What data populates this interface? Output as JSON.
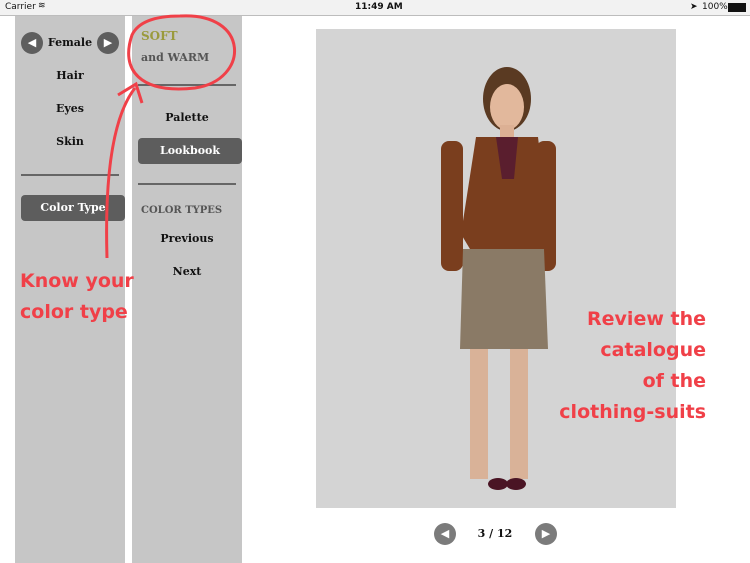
{
  "status": {
    "carrier": "Carrier",
    "time": "11:49 AM",
    "battery": "100%"
  },
  "left": {
    "gender": "Female",
    "items": [
      "Hair",
      "Eyes",
      "Skin"
    ],
    "color_type_button": "Color Type"
  },
  "middle": {
    "type_line1": "SOFT",
    "type_line2": "and WARM",
    "palette": "Palette",
    "lookbook": "Lookbook",
    "section": "COLOR TYPES",
    "previous": "Previous",
    "next": "Next"
  },
  "annotations": {
    "left_line1": "Know your",
    "left_line2": "color type",
    "right": [
      "Review the",
      "catalogue",
      "of the",
      "clothing-suits"
    ]
  },
  "pager": {
    "text": "3 / 12"
  },
  "colors": {
    "accent_text": "#9a9a3c",
    "annotation": "#f04048"
  }
}
